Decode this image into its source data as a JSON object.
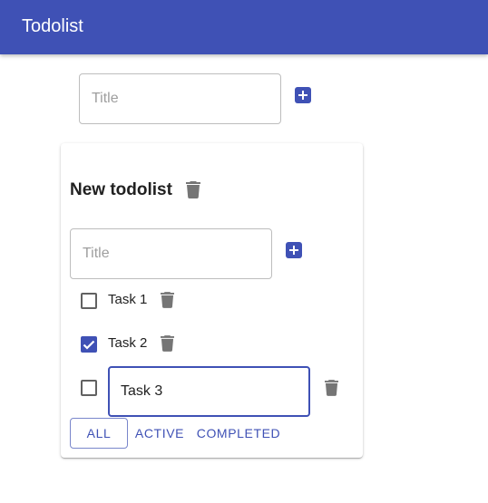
{
  "app": {
    "title": "Todolist"
  },
  "new_list": {
    "placeholder": "Title"
  },
  "todolist": {
    "title": "New todolist",
    "new_task": {
      "placeholder": "Title"
    },
    "tasks": [
      {
        "label": "Task 1",
        "done": false
      },
      {
        "label": "Task 2",
        "done": true
      },
      {
        "label": "Task 3",
        "done": false,
        "editing": true
      }
    ],
    "filters": [
      {
        "label": "ALL",
        "active": true
      },
      {
        "label": "ACTIVE",
        "active": false
      },
      {
        "label": "COMPLETED",
        "active": false
      }
    ]
  },
  "icons": {
    "add": "plus-icon",
    "delete": "trash-icon",
    "check": "check-icon"
  },
  "colors": {
    "primary": "#3f51b5",
    "icon_gray": "#757575",
    "outline": "#7986cb"
  }
}
